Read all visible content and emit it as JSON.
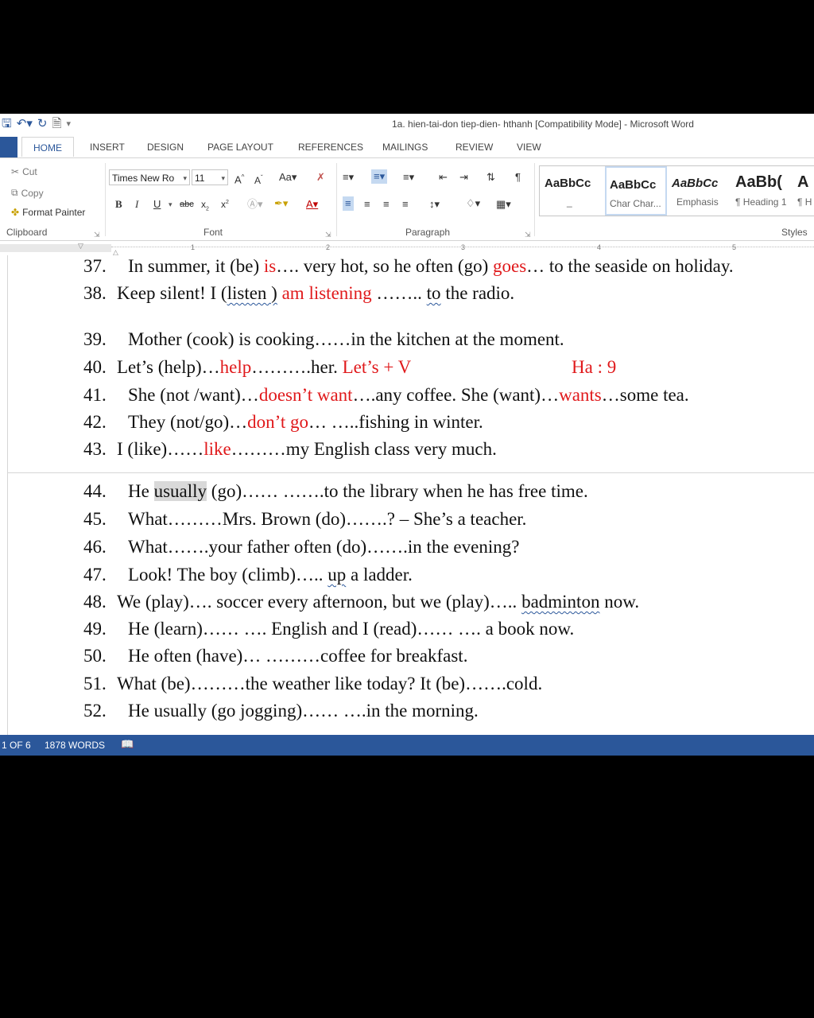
{
  "window": {
    "title": "1a. hien-tai-don tiep-dien- hthanh [Compatibility Mode] - Microsoft Word"
  },
  "tabs": [
    "HOME",
    "INSERT",
    "DESIGN",
    "PAGE LAYOUT",
    "REFERENCES",
    "MAILINGS",
    "REVIEW",
    "VIEW"
  ],
  "clipboard": {
    "cut": "Cut",
    "copy": "Copy",
    "format_painter": "Format Painter",
    "label": "Clipboard"
  },
  "font": {
    "name": "Times New Ro",
    "size": "11",
    "label": "Font"
  },
  "paragraph": {
    "label": "Paragraph"
  },
  "styles": {
    "label": "Styles",
    "items": [
      {
        "sample": "AaBbCc",
        "name": "_"
      },
      {
        "sample": "AaBbCc",
        "name": "Char Char..."
      },
      {
        "sample": "AaBbCc",
        "name": "Emphasis"
      },
      {
        "sample": "AaBb(",
        "name": "¶ Heading 1"
      },
      {
        "sample": "A",
        "name": "¶ H"
      }
    ]
  },
  "ruler": [
    "1",
    "2",
    "3",
    "4",
    "5"
  ],
  "document": {
    "l37": {
      "num": "37.",
      "a": "In summer, it (be) ",
      "b": "is",
      "c": "…. very hot, so he often (go) ",
      "d": "goes",
      "e": "… to the seaside on holiday."
    },
    "l38": {
      "num": "38.",
      "a": "Keep silent! I (",
      "b": "listen )",
      "c": " ",
      "d": "am listening",
      "e": " …….. ",
      "f": "to",
      "g": " the radio."
    },
    "l39": {
      "num": "39.",
      "a": "Mother (cook) is cooking……in the kitchen at the moment."
    },
    "l40": {
      "num": "40.",
      "a": "Let’s (help)…",
      "b": "help",
      "c": "……….her. ",
      "d": "Let’s + V",
      "ha": "Ha : 9"
    },
    "l41": {
      "num": "41.",
      "a": "She (not /want)…",
      "b": "doesn’t want",
      "c": "….any coffee. She (want)…",
      "d": "wants",
      "e": "…some tea."
    },
    "l42": {
      "num": "42.",
      "a": "They (not/go)…",
      "b": "don’t go",
      "c": "… …..fishing in winter."
    },
    "l43": {
      "num": "43.",
      "a": "I (like)……",
      "b": "like",
      "c": "………my English class very much."
    },
    "l44": {
      "num": "44.",
      "a": "He ",
      "b": "usually",
      "c": " (go)…… …….to the library when he has free time."
    },
    "l45": {
      "num": "45.",
      "a": "What………Mrs. Brown (do)…….? – She’s a teacher."
    },
    "l46": {
      "num": "46.",
      "a": "What…….your father often (do)…….in the evening?"
    },
    "l47": {
      "num": "47.",
      "a": "Look! The boy (climb)….. ",
      "b": "up",
      "c": " a ladder."
    },
    "l48": {
      "num": "48.",
      "a": "We (play)…. soccer every afternoon, but we (play)….. ",
      "b": "badminton",
      "c": " now."
    },
    "l49": {
      "num": "49.",
      "a": "He (learn)…… …. English and I (read)…… …. a book now."
    },
    "l50": {
      "num": "50.",
      "a": "He often (have)… ………coffee for breakfast."
    },
    "l51": {
      "num": "51.",
      "a": "What (be)………the weather like today? It (be)…….cold."
    },
    "l52": {
      "num": "52.",
      "a": "He usually (go jogging)…… ….in the morning."
    }
  },
  "status": {
    "page": "1 OF 6",
    "words": "1878 WORDS"
  },
  "colors": {
    "accent": "#2b579a",
    "answer_red": "#e0191b"
  }
}
